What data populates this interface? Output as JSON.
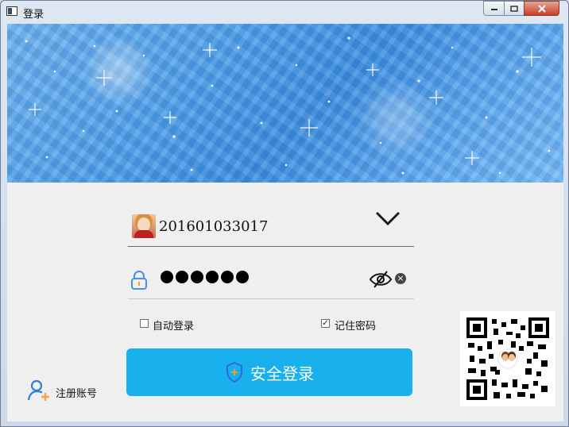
{
  "window": {
    "title": "登录",
    "controls": {
      "minimize_icon": "minimize-icon",
      "maximize_icon": "maximize-icon",
      "close_icon": "close-icon"
    }
  },
  "banner": {
    "description_icon": "sparkle-blue-banner"
  },
  "login": {
    "account": "201601033017",
    "password_mask_count": 6,
    "auto_login_label": "自动登录",
    "auto_login_checked": false,
    "remember_password_label": "记住密码",
    "remember_password_checked": true,
    "login_button_label": "安全登录",
    "register_label": "注册账号"
  },
  "colors": {
    "accent": "#19b0ee",
    "lock_icon": "#4a90e2",
    "register_icon": "#2f7fd6",
    "register_plus": "#f4a640"
  }
}
